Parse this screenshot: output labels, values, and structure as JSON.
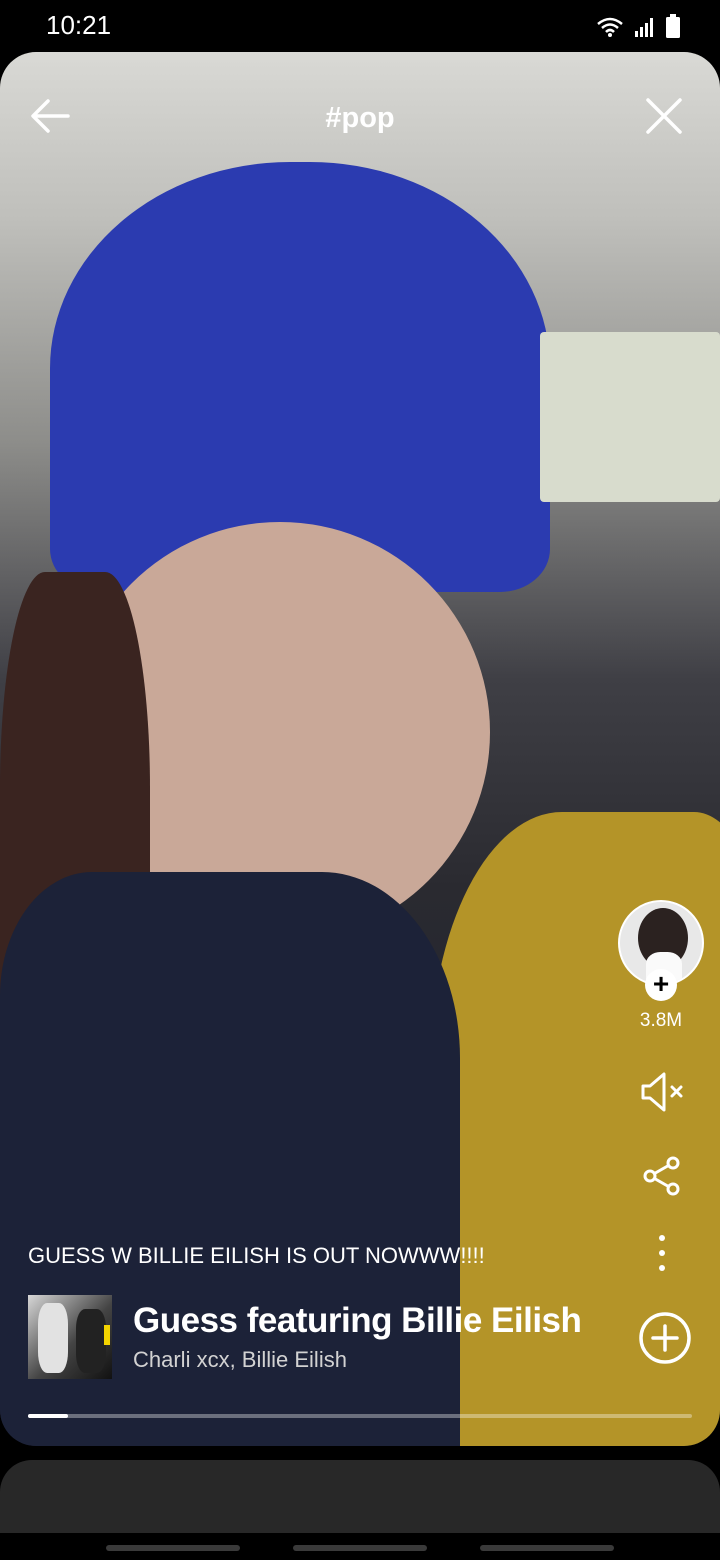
{
  "status_bar": {
    "time": "10:21",
    "icons": [
      "wifi-icon",
      "signal-icon",
      "battery-icon"
    ]
  },
  "header": {
    "hashtag": "#pop",
    "back_icon": "arrow-left-icon",
    "close_icon": "close-icon"
  },
  "rail": {
    "like_count": "3.8M",
    "follow_symbol": "+",
    "mute_icon": "speaker-muted-icon",
    "share_icon": "share-icon",
    "more_icon": "more-vertical-icon"
  },
  "caption": "GUESS W BILLIE EILISH IS OUT NOWWW!!!!",
  "track": {
    "title": "Guess featuring Billie Eilish",
    "artist": "Charli xcx, Billie Eilish",
    "add_icon": "plus-circle-icon"
  },
  "progress": {
    "fraction": 0.06
  },
  "colors": {
    "background": "#000000",
    "sheet": "#282828",
    "text": "#ffffff",
    "subtext": "#d2d2d2"
  }
}
